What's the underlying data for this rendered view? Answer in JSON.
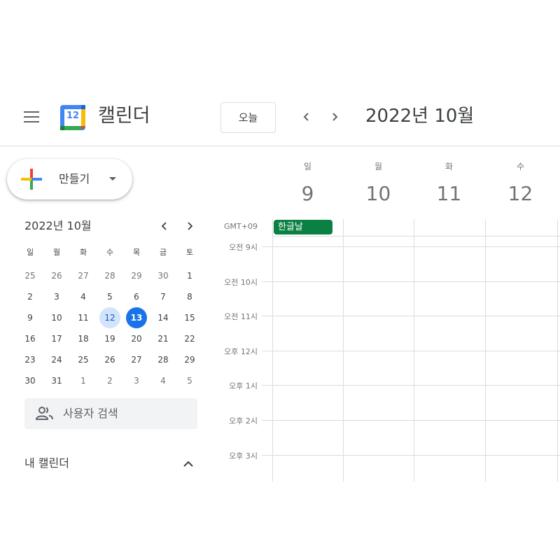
{
  "header": {
    "app_name": "캘린더",
    "logo_number": "12",
    "today_label": "오늘",
    "date_title": "2022년 10월"
  },
  "sidebar": {
    "create_label": "만들기",
    "mini_calendar": {
      "title": "2022년 10월",
      "weekdays": [
        "일",
        "월",
        "화",
        "수",
        "목",
        "금",
        "토"
      ],
      "weeks": [
        [
          "25",
          "26",
          "27",
          "28",
          "29",
          "30",
          "1"
        ],
        [
          "2",
          "3",
          "4",
          "5",
          "6",
          "7",
          "8"
        ],
        [
          "9",
          "10",
          "11",
          "12",
          "13",
          "14",
          "15"
        ],
        [
          "16",
          "17",
          "18",
          "19",
          "20",
          "21",
          "22"
        ],
        [
          "23",
          "24",
          "25",
          "26",
          "27",
          "28",
          "29"
        ],
        [
          "30",
          "31",
          "1",
          "2",
          "3",
          "4",
          "5"
        ]
      ],
      "selected_day": "12",
      "today_day": "13"
    },
    "search_placeholder": "사용자 검색",
    "my_calendars_label": "내 캘린더"
  },
  "week_view": {
    "days": [
      {
        "dow": "일",
        "num": "9"
      },
      {
        "dow": "월",
        "num": "10"
      },
      {
        "dow": "화",
        "num": "11"
      },
      {
        "dow": "수",
        "num": "12"
      }
    ],
    "timezone": "GMT+09",
    "all_day_event": {
      "title": "한글날",
      "color": "#0b8043"
    },
    "hours": [
      "오전 9시",
      "오전 10시",
      "오전 11시",
      "오후 12시",
      "오후 1시",
      "오후 2시",
      "오후 3시"
    ]
  },
  "colors": {
    "accent": "#1a73e8",
    "selected_bg": "#d2e3fc",
    "event_green": "#0b8043"
  }
}
